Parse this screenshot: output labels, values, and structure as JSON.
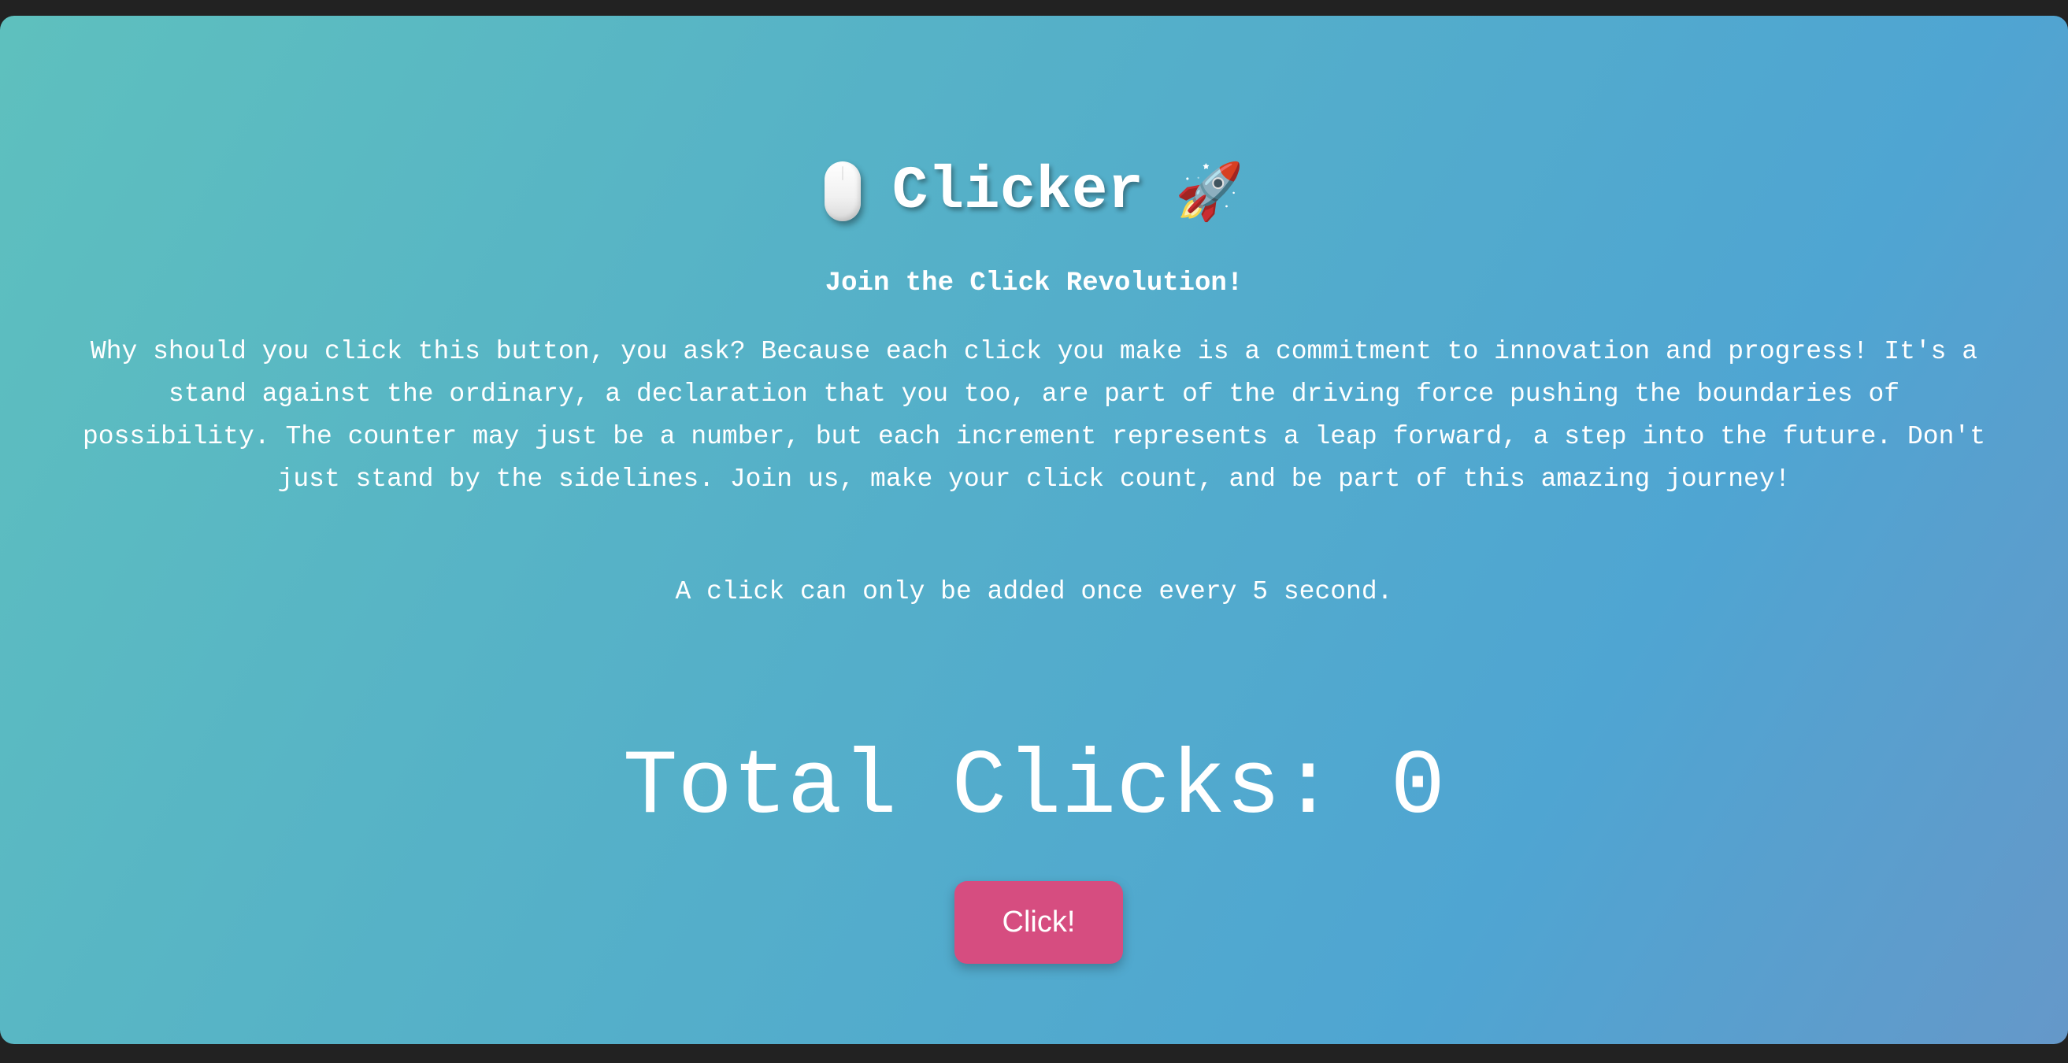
{
  "header": {
    "title": "Clicker",
    "left_icon": "computer-mouse-icon",
    "right_icon": "rocket-icon",
    "right_icon_glyph": "🚀"
  },
  "subtitle": "Join the Click Revolution!",
  "description": "Why should you click this button, you ask? Because each click you make is a commitment to innovation and progress! It's a stand against the ordinary, a declaration that you too, are part of the driving force pushing the boundaries of possibility. The counter may just be a number, but each increment represents a leap forward, a step into the future. Don't just stand by the sidelines. Join us, make your click count, and be part of this amazing journey!",
  "rate_note": "A click can only be added once every 5 second.",
  "counter": {
    "label": "Total Clicks:",
    "value": "0"
  },
  "button": {
    "label": "Click!"
  },
  "colors": {
    "background_outer": "#222222",
    "gradient_start": "#5ec0be",
    "gradient_end": "#6598c9",
    "button": "#d64d80",
    "text": "#ffffff"
  }
}
